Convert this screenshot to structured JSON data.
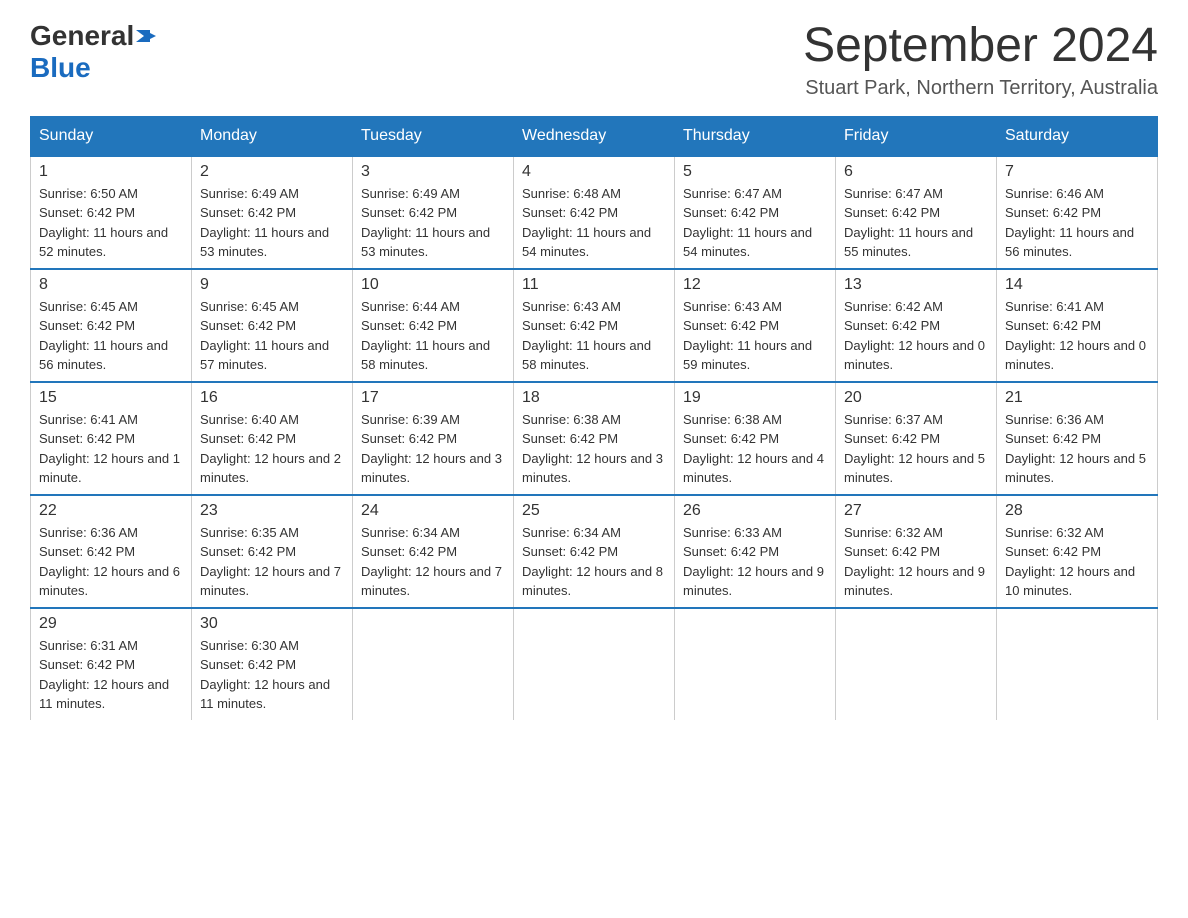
{
  "header": {
    "logo_general": "General",
    "logo_blue": "Blue",
    "calendar_title": "September 2024",
    "calendar_subtitle": "Stuart Park, Northern Territory, Australia"
  },
  "weekdays": [
    "Sunday",
    "Monday",
    "Tuesday",
    "Wednesday",
    "Thursday",
    "Friday",
    "Saturday"
  ],
  "weeks": [
    [
      {
        "day": "1",
        "sunrise": "6:50 AM",
        "sunset": "6:42 PM",
        "daylight": "11 hours and 52 minutes."
      },
      {
        "day": "2",
        "sunrise": "6:49 AM",
        "sunset": "6:42 PM",
        "daylight": "11 hours and 53 minutes."
      },
      {
        "day": "3",
        "sunrise": "6:49 AM",
        "sunset": "6:42 PM",
        "daylight": "11 hours and 53 minutes."
      },
      {
        "day": "4",
        "sunrise": "6:48 AM",
        "sunset": "6:42 PM",
        "daylight": "11 hours and 54 minutes."
      },
      {
        "day": "5",
        "sunrise": "6:47 AM",
        "sunset": "6:42 PM",
        "daylight": "11 hours and 54 minutes."
      },
      {
        "day": "6",
        "sunrise": "6:47 AM",
        "sunset": "6:42 PM",
        "daylight": "11 hours and 55 minutes."
      },
      {
        "day": "7",
        "sunrise": "6:46 AM",
        "sunset": "6:42 PM",
        "daylight": "11 hours and 56 minutes."
      }
    ],
    [
      {
        "day": "8",
        "sunrise": "6:45 AM",
        "sunset": "6:42 PM",
        "daylight": "11 hours and 56 minutes."
      },
      {
        "day": "9",
        "sunrise": "6:45 AM",
        "sunset": "6:42 PM",
        "daylight": "11 hours and 57 minutes."
      },
      {
        "day": "10",
        "sunrise": "6:44 AM",
        "sunset": "6:42 PM",
        "daylight": "11 hours and 58 minutes."
      },
      {
        "day": "11",
        "sunrise": "6:43 AM",
        "sunset": "6:42 PM",
        "daylight": "11 hours and 58 minutes."
      },
      {
        "day": "12",
        "sunrise": "6:43 AM",
        "sunset": "6:42 PM",
        "daylight": "11 hours and 59 minutes."
      },
      {
        "day": "13",
        "sunrise": "6:42 AM",
        "sunset": "6:42 PM",
        "daylight": "12 hours and 0 minutes."
      },
      {
        "day": "14",
        "sunrise": "6:41 AM",
        "sunset": "6:42 PM",
        "daylight": "12 hours and 0 minutes."
      }
    ],
    [
      {
        "day": "15",
        "sunrise": "6:41 AM",
        "sunset": "6:42 PM",
        "daylight": "12 hours and 1 minute."
      },
      {
        "day": "16",
        "sunrise": "6:40 AM",
        "sunset": "6:42 PM",
        "daylight": "12 hours and 2 minutes."
      },
      {
        "day": "17",
        "sunrise": "6:39 AM",
        "sunset": "6:42 PM",
        "daylight": "12 hours and 3 minutes."
      },
      {
        "day": "18",
        "sunrise": "6:38 AM",
        "sunset": "6:42 PM",
        "daylight": "12 hours and 3 minutes."
      },
      {
        "day": "19",
        "sunrise": "6:38 AM",
        "sunset": "6:42 PM",
        "daylight": "12 hours and 4 minutes."
      },
      {
        "day": "20",
        "sunrise": "6:37 AM",
        "sunset": "6:42 PM",
        "daylight": "12 hours and 5 minutes."
      },
      {
        "day": "21",
        "sunrise": "6:36 AM",
        "sunset": "6:42 PM",
        "daylight": "12 hours and 5 minutes."
      }
    ],
    [
      {
        "day": "22",
        "sunrise": "6:36 AM",
        "sunset": "6:42 PM",
        "daylight": "12 hours and 6 minutes."
      },
      {
        "day": "23",
        "sunrise": "6:35 AM",
        "sunset": "6:42 PM",
        "daylight": "12 hours and 7 minutes."
      },
      {
        "day": "24",
        "sunrise": "6:34 AM",
        "sunset": "6:42 PM",
        "daylight": "12 hours and 7 minutes."
      },
      {
        "day": "25",
        "sunrise": "6:34 AM",
        "sunset": "6:42 PM",
        "daylight": "12 hours and 8 minutes."
      },
      {
        "day": "26",
        "sunrise": "6:33 AM",
        "sunset": "6:42 PM",
        "daylight": "12 hours and 9 minutes."
      },
      {
        "day": "27",
        "sunrise": "6:32 AM",
        "sunset": "6:42 PM",
        "daylight": "12 hours and 9 minutes."
      },
      {
        "day": "28",
        "sunrise": "6:32 AM",
        "sunset": "6:42 PM",
        "daylight": "12 hours and 10 minutes."
      }
    ],
    [
      {
        "day": "29",
        "sunrise": "6:31 AM",
        "sunset": "6:42 PM",
        "daylight": "12 hours and 11 minutes."
      },
      {
        "day": "30",
        "sunrise": "6:30 AM",
        "sunset": "6:42 PM",
        "daylight": "12 hours and 11 minutes."
      },
      null,
      null,
      null,
      null,
      null
    ]
  ],
  "labels": {
    "sunrise": "Sunrise:",
    "sunset": "Sunset:",
    "daylight": "Daylight:"
  }
}
